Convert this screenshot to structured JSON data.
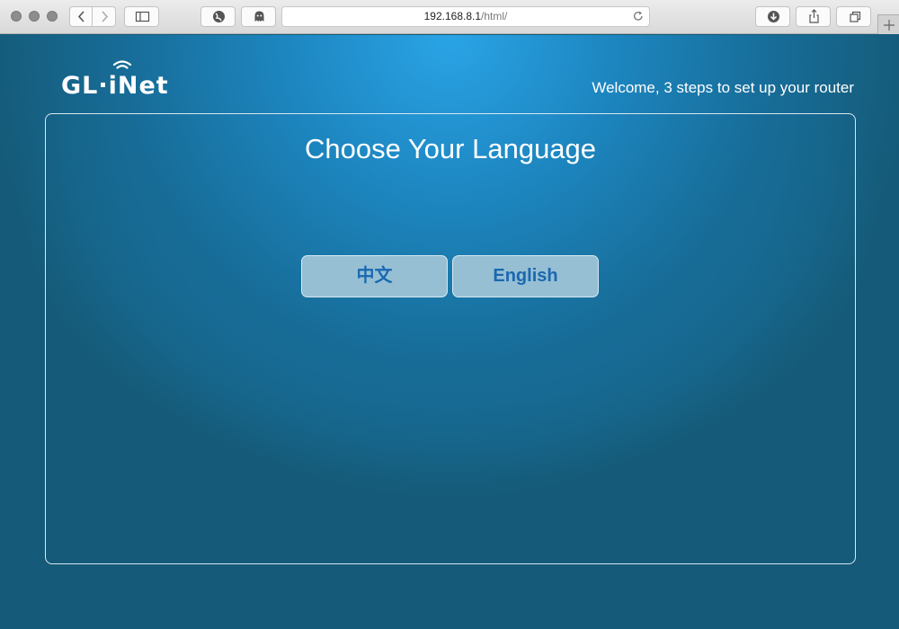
{
  "browser": {
    "url_host": "192.168.8.1",
    "url_path": "/html/"
  },
  "header": {
    "logo_text": "GL·iNet",
    "welcome": "Welcome, 3 steps to set up your router"
  },
  "main": {
    "title": "Choose Your Language",
    "languages": [
      {
        "label": "中文"
      },
      {
        "label": "English"
      }
    ]
  },
  "colors": {
    "page_bg": "#155a78",
    "accent_glow": "#2aa4e6",
    "button_bg": "#96bfd4",
    "button_text": "#1a68b0"
  }
}
